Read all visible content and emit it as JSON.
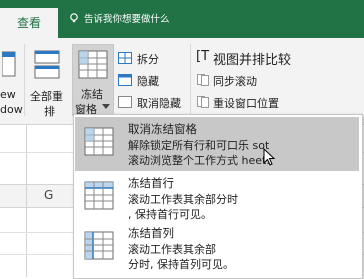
{
  "tabs": {
    "view": "查看"
  },
  "search": {
    "placeholder": "告诉我你想要做什么"
  },
  "ribbon": {
    "view_left1": "ew",
    "view_left2": "dow",
    "reset_all_1": "全部重",
    "reset_all_2": "排",
    "freeze_1": "冻结",
    "freeze_2": "窗格",
    "split": "拆分",
    "hide": "隐藏",
    "unhide": "取消隐藏",
    "side_by_side": "视图并排比较",
    "sync_scroll": "同步滚动",
    "reset_position": "重设窗口位置"
  },
  "grid": {
    "col_g": "G"
  },
  "menu": {
    "items": [
      {
        "title": "取消冻结窗格",
        "desc1": "解除锁定所有行和可口乐 sot",
        "desc2": "滚动浏览整个工作方式 heet."
      },
      {
        "title": "冻结首行",
        "desc1": "滚动工作表其余部分时",
        "desc2": ", 保持首行可见。"
      },
      {
        "title": "冻结首列",
        "desc1": "滚动工作表其余部",
        "desc2": "分时, 保持首列可见。"
      }
    ]
  },
  "colors": {
    "brand": "#217346",
    "ribbon": "#f3f3f3",
    "hover": "#c8c8c8"
  }
}
